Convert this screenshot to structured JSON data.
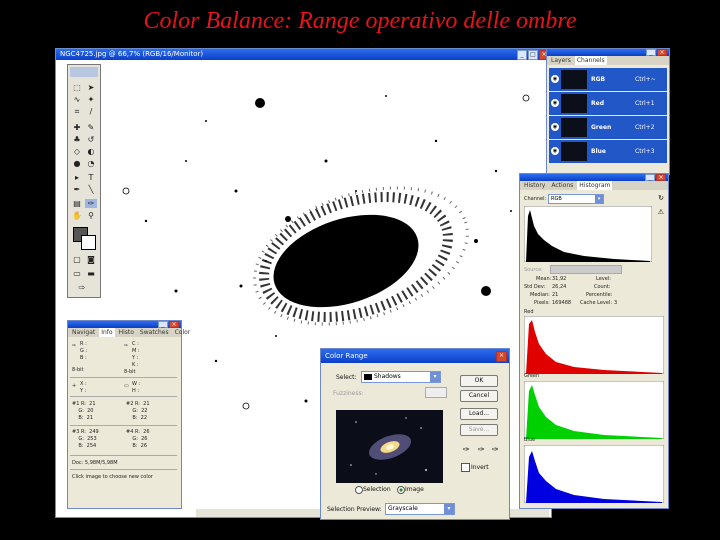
{
  "slide": {
    "title": "Color Balance: Range operativo delle ombre",
    "title_color": "#e8121b"
  },
  "document": {
    "title": "NGC4725.jpg @ 66,7% (RGB/16/Monitor)"
  },
  "layers_panel": {
    "tabs": [
      "Layers",
      "Channels"
    ],
    "channels": [
      {
        "name": "RGB",
        "shortcut": "Ctrl+~"
      },
      {
        "name": "Red",
        "shortcut": "Ctrl+1"
      },
      {
        "name": "Green",
        "shortcut": "Ctrl+2"
      },
      {
        "name": "Blue",
        "shortcut": "Ctrl+3"
      }
    ]
  },
  "histogram_panel": {
    "tabs": [
      "History",
      "Actions",
      "Histogram"
    ],
    "channel_label": "Channel:",
    "channel_value": "RGB",
    "source_label": "Source:",
    "stats": {
      "mean_label": "Mean:",
      "mean": "31,92",
      "std_label": "Std Dev:",
      "std": "26,24",
      "median_label": "Median:",
      "median": "21",
      "pixels_label": "Pixels:",
      "pixels": "169488",
      "level_label": "Level:",
      "count_label": "Count:",
      "percentile_label": "Percentile:",
      "cache_label": "Cache Level:",
      "cache": "3"
    },
    "channels": [
      {
        "name": "Red",
        "color": "#e00000"
      },
      {
        "name": "Green",
        "color": "#00d000"
      },
      {
        "name": "Blue",
        "color": "#0000e0"
      }
    ],
    "composite_color": "#000000"
  },
  "info_panel": {
    "tabs": [
      "Navigat",
      "Info",
      "Histo",
      "Swatches",
      "Color"
    ],
    "rgb_left": [
      "R :",
      "G :",
      "B :"
    ],
    "cmyk_right": [
      "C :",
      "M :",
      "Y :",
      "K :"
    ],
    "bit_left": "8-bit",
    "bit_right": "8-bit",
    "xy_left": [
      "X :",
      "Y :"
    ],
    "wh_right": [
      "W :",
      "H :"
    ],
    "samples": [
      {
        "id": "#1",
        "R": "21",
        "G": "20",
        "B": "21"
      },
      {
        "id": "#2",
        "R": "21",
        "G": "22",
        "B": "22"
      },
      {
        "id": "#3",
        "R": "249",
        "G": "253",
        "B": "254"
      },
      {
        "id": "#4",
        "R": "26",
        "G": "26",
        "B": "26"
      }
    ],
    "doc": "Doc: 5,98M/5,98M",
    "hint": "Click image to choose new color"
  },
  "color_range": {
    "title": "Color Range",
    "select_label": "Select:",
    "select_value": "Shadows",
    "fuzziness_label": "Fuzziness:",
    "ok": "OK",
    "cancel": "Cancel",
    "load": "Load...",
    "save": "Save...",
    "invert": "Invert",
    "selection": "Selection",
    "image": "Image",
    "preview_label": "Selection Preview:",
    "preview_value": "Grayscale"
  },
  "icons": [
    "close-icon",
    "minimize-icon",
    "maximize-icon",
    "eye-icon",
    "eyedropper-icon",
    "eyedropper-plus-icon",
    "eyedropper-minus-icon",
    "chevron-down-icon"
  ]
}
